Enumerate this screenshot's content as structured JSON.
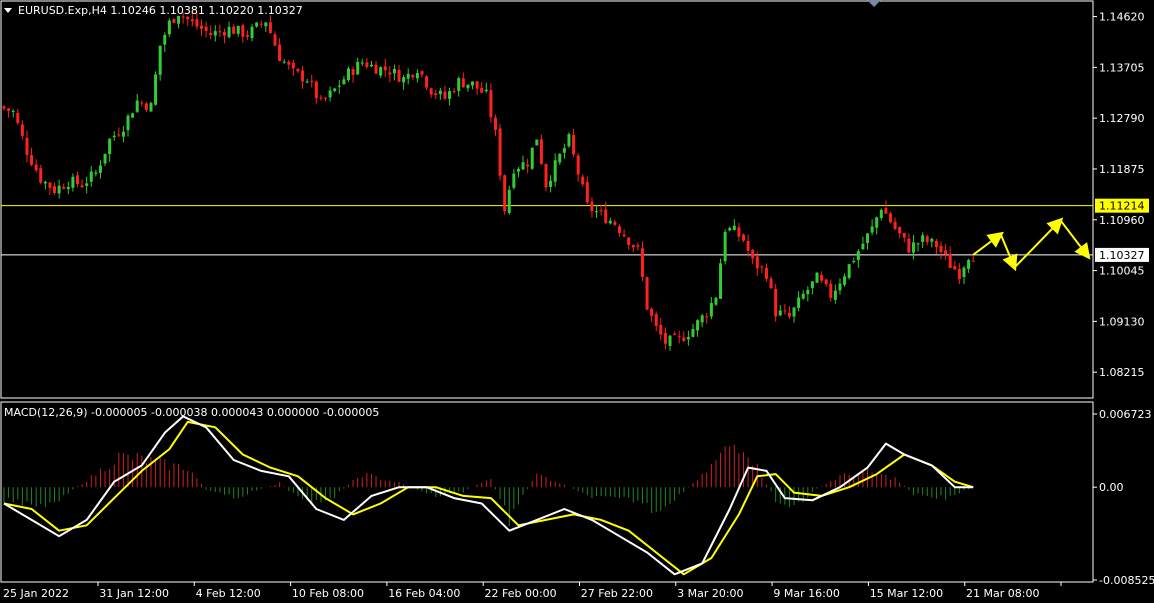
{
  "header": {
    "symbol_line": "EURUSD.Exp,H4  1.10246 1.10381 1.10220 1.10327"
  },
  "indicator": {
    "label": "MACD(12,26,9) -0.000005 -0.000038 0.000043 0.000000 -0.000005"
  },
  "chart_data": {
    "type": "candlestick",
    "symbol": "EURUSD.Exp",
    "timeframe": "H4",
    "ohlc_last": {
      "open": 1.10246,
      "high": 1.10381,
      "low": 1.1022,
      "close": 1.10327
    },
    "price_axis_ticks": [
      "1.14620",
      "1.13705",
      "1.12790",
      "1.11875",
      "1.10960",
      "1.10045",
      "1.09130",
      "1.08215"
    ],
    "price_range": [
      1.0775,
      1.149
    ],
    "horizontal_lines": [
      {
        "price": 1.11214,
        "label": "1.11214",
        "color": "#ffff00"
      },
      {
        "price": 1.10327,
        "label": "1.10327",
        "color": "#ffffff"
      }
    ],
    "time_axis_labels": [
      "25 Jan 2022",
      "31 Jan 12:00",
      "4 Feb 12:00",
      "10 Feb 08:00",
      "16 Feb 04:00",
      "22 Feb 00:00",
      "27 Feb 22:00",
      "3 Mar 20:00",
      "9 Mar 16:00",
      "15 Mar 12:00",
      "21 Mar 08:00"
    ],
    "price_path": [
      {
        "t": 0,
        "p": 1.13
      },
      {
        "t": 3,
        "p": 1.129
      },
      {
        "t": 6,
        "p": 1.122
      },
      {
        "t": 9,
        "p": 1.117
      },
      {
        "t": 12,
        "p": 1.115
      },
      {
        "t": 15,
        "p": 1.1165
      },
      {
        "t": 18,
        "p": 1.116
      },
      {
        "t": 21,
        "p": 1.118
      },
      {
        "t": 24,
        "p": 1.124
      },
      {
        "t": 27,
        "p": 1.1265
      },
      {
        "t": 30,
        "p": 1.131
      },
      {
        "t": 33,
        "p": 1.13
      },
      {
        "t": 35,
        "p": 1.141
      },
      {
        "t": 37,
        "p": 1.145
      },
      {
        "t": 39,
        "p": 1.147
      },
      {
        "t": 42,
        "p": 1.145
      },
      {
        "t": 46,
        "p": 1.143
      },
      {
        "t": 50,
        "p": 1.144
      },
      {
        "t": 54,
        "p": 1.143
      },
      {
        "t": 58,
        "p": 1.1455
      },
      {
        "t": 61,
        "p": 1.139
      },
      {
        "t": 64,
        "p": 1.136
      },
      {
        "t": 67,
        "p": 1.135
      },
      {
        "t": 70,
        "p": 1.1305
      },
      {
        "t": 73,
        "p": 1.133
      },
      {
        "t": 76,
        "p": 1.136
      },
      {
        "t": 79,
        "p": 1.138
      },
      {
        "t": 82,
        "p": 1.137
      },
      {
        "t": 85,
        "p": 1.1365
      },
      {
        "t": 88,
        "p": 1.135
      },
      {
        "t": 91,
        "p": 1.137
      },
      {
        "t": 94,
        "p": 1.133
      },
      {
        "t": 97,
        "p": 1.1315
      },
      {
        "t": 100,
        "p": 1.1345
      },
      {
        "t": 103,
        "p": 1.134
      },
      {
        "t": 106,
        "p": 1.132
      },
      {
        "t": 108,
        "p": 1.125
      },
      {
        "t": 110,
        "p": 1.1115
      },
      {
        "t": 112,
        "p": 1.119
      },
      {
        "t": 115,
        "p": 1.12
      },
      {
        "t": 117,
        "p": 1.1245
      },
      {
        "t": 119,
        "p": 1.116
      },
      {
        "t": 122,
        "p": 1.121
      },
      {
        "t": 124,
        "p": 1.124
      },
      {
        "t": 126,
        "p": 1.118
      },
      {
        "t": 128,
        "p": 1.112
      },
      {
        "t": 131,
        "p": 1.1105
      },
      {
        "t": 134,
        "p": 1.109
      },
      {
        "t": 137,
        "p": 1.106
      },
      {
        "t": 139,
        "p": 1.104
      },
      {
        "t": 141,
        "p": 1.094
      },
      {
        "t": 143,
        "p": 1.09
      },
      {
        "t": 145,
        "p": 1.0875
      },
      {
        "t": 148,
        "p": 1.088
      },
      {
        "t": 151,
        "p": 1.09
      },
      {
        "t": 154,
        "p": 1.093
      },
      {
        "t": 156,
        "p": 1.096
      },
      {
        "t": 158,
        "p": 1.108
      },
      {
        "t": 160,
        "p": 1.1075
      },
      {
        "t": 162,
        "p": 1.106
      },
      {
        "t": 164,
        "p": 1.102
      },
      {
        "t": 167,
        "p": 1.1
      },
      {
        "t": 169,
        "p": 1.093
      },
      {
        "t": 172,
        "p": 1.092
      },
      {
        "t": 175,
        "p": 1.096
      },
      {
        "t": 178,
        "p": 1.099
      },
      {
        "t": 181,
        "p": 1.096
      },
      {
        "t": 184,
        "p": 1.1
      },
      {
        "t": 187,
        "p": 1.104
      },
      {
        "t": 190,
        "p": 1.108
      },
      {
        "t": 192,
        "p": 1.112
      },
      {
        "t": 195,
        "p": 1.108
      },
      {
        "t": 198,
        "p": 1.1045
      },
      {
        "t": 201,
        "p": 1.106
      },
      {
        "t": 204,
        "p": 1.105
      },
      {
        "t": 207,
        "p": 1.1015
      },
      {
        "t": 209,
        "p": 1.1
      },
      {
        "t": 211,
        "p": 1.1033
      }
    ],
    "projection_arrows": [
      {
        "from": {
          "t": 211,
          "p": 1.1033
        },
        "to": {
          "t": 217,
          "p": 1.107
        }
      },
      {
        "from": {
          "t": 217,
          "p": 1.107
        },
        "to": {
          "t": 220,
          "p": 1.101
        }
      },
      {
        "from": {
          "t": 220,
          "p": 1.101
        },
        "to": {
          "t": 230,
          "p": 1.1095
        }
      },
      {
        "from": {
          "t": 230,
          "p": 1.1095
        },
        "to": {
          "t": 236,
          "p": 1.103
        }
      }
    ],
    "macd": {
      "params": "12,26,9",
      "axis_ticks": [
        "0.006723",
        "0.00",
        "-0.008525"
      ],
      "range": [
        -0.008525,
        0.006723
      ],
      "histogram": [
        {
          "t": 0,
          "v": -0.0012
        },
        {
          "t": 10,
          "v": -0.0016
        },
        {
          "t": 20,
          "v": 0.0012
        },
        {
          "t": 25,
          "v": 0.0028
        },
        {
          "t": 30,
          "v": 0.0026
        },
        {
          "t": 36,
          "v": 0.002
        },
        {
          "t": 40,
          "v": 0.0018
        },
        {
          "t": 44,
          "v": -0.0002
        },
        {
          "t": 50,
          "v": -0.001
        },
        {
          "t": 60,
          "v": 0.0004
        },
        {
          "t": 66,
          "v": -0.0016
        },
        {
          "t": 72,
          "v": -0.0008
        },
        {
          "t": 78,
          "v": 0.0012
        },
        {
          "t": 86,
          "v": 0.0004
        },
        {
          "t": 94,
          "v": -0.0008
        },
        {
          "t": 100,
          "v": -0.0004
        },
        {
          "t": 106,
          "v": 0.0008
        },
        {
          "t": 110,
          "v": -0.003
        },
        {
          "t": 116,
          "v": 0.0012
        },
        {
          "t": 120,
          "v": 0.0006
        },
        {
          "t": 126,
          "v": -0.0006
        },
        {
          "t": 130,
          "v": -0.001
        },
        {
          "t": 138,
          "v": -0.0012
        },
        {
          "t": 142,
          "v": -0.0022
        },
        {
          "t": 148,
          "v": -0.0004
        },
        {
          "t": 152,
          "v": 0.001
        },
        {
          "t": 158,
          "v": 0.0038
        },
        {
          "t": 161,
          "v": 0.004
        },
        {
          "t": 164,
          "v": 0.0018
        },
        {
          "t": 168,
          "v": -0.0012
        },
        {
          "t": 172,
          "v": -0.002
        },
        {
          "t": 176,
          "v": -0.0004
        },
        {
          "t": 182,
          "v": 0.001
        },
        {
          "t": 188,
          "v": 0.0014
        },
        {
          "t": 194,
          "v": 0.0008
        },
        {
          "t": 198,
          "v": -0.0006
        },
        {
          "t": 205,
          "v": -0.001
        },
        {
          "t": 211,
          "v": 0.0
        }
      ],
      "macd_line": [
        {
          "t": 0,
          "v": -0.0015
        },
        {
          "t": 6,
          "v": -0.003
        },
        {
          "t": 12,
          "v": -0.0045
        },
        {
          "t": 18,
          "v": -0.003
        },
        {
          "t": 24,
          "v": 0.0005
        },
        {
          "t": 30,
          "v": 0.002
        },
        {
          "t": 35,
          "v": 0.005
        },
        {
          "t": 39,
          "v": 0.0065
        },
        {
          "t": 44,
          "v": 0.0055
        },
        {
          "t": 50,
          "v": 0.0025
        },
        {
          "t": 56,
          "v": 0.0015
        },
        {
          "t": 62,
          "v": 0.001
        },
        {
          "t": 68,
          "v": -0.002
        },
        {
          "t": 74,
          "v": -0.003
        },
        {
          "t": 80,
          "v": -0.0008
        },
        {
          "t": 86,
          "v": 0.0
        },
        {
          "t": 92,
          "v": 0.0
        },
        {
          "t": 98,
          "v": -0.001
        },
        {
          "t": 104,
          "v": -0.0015
        },
        {
          "t": 110,
          "v": -0.004
        },
        {
          "t": 116,
          "v": -0.003
        },
        {
          "t": 122,
          "v": -0.002
        },
        {
          "t": 128,
          "v": -0.003
        },
        {
          "t": 134,
          "v": -0.0045
        },
        {
          "t": 140,
          "v": -0.006
        },
        {
          "t": 146,
          "v": -0.008
        },
        {
          "t": 152,
          "v": -0.007
        },
        {
          "t": 158,
          "v": -0.002
        },
        {
          "t": 162,
          "v": 0.0018
        },
        {
          "t": 166,
          "v": 0.0015
        },
        {
          "t": 170,
          "v": -0.001
        },
        {
          "t": 176,
          "v": -0.0012
        },
        {
          "t": 182,
          "v": 0.0
        },
        {
          "t": 188,
          "v": 0.0018
        },
        {
          "t": 192,
          "v": 0.004
        },
        {
          "t": 196,
          "v": 0.003
        },
        {
          "t": 202,
          "v": 0.002
        },
        {
          "t": 207,
          "v": 0.0
        },
        {
          "t": 211,
          "v": 0.0
        }
      ],
      "signal_line": [
        {
          "t": 0,
          "v": -0.0015
        },
        {
          "t": 6,
          "v": -0.002
        },
        {
          "t": 12,
          "v": -0.004
        },
        {
          "t": 18,
          "v": -0.0035
        },
        {
          "t": 24,
          "v": -0.001
        },
        {
          "t": 30,
          "v": 0.0015
        },
        {
          "t": 36,
          "v": 0.0035
        },
        {
          "t": 40,
          "v": 0.006
        },
        {
          "t": 46,
          "v": 0.0055
        },
        {
          "t": 52,
          "v": 0.003
        },
        {
          "t": 58,
          "v": 0.0018
        },
        {
          "t": 64,
          "v": 0.001
        },
        {
          "t": 70,
          "v": -0.001
        },
        {
          "t": 76,
          "v": -0.0025
        },
        {
          "t": 82,
          "v": -0.0015
        },
        {
          "t": 88,
          "v": 0.0
        },
        {
          "t": 94,
          "v": 0.0
        },
        {
          "t": 100,
          "v": -0.0008
        },
        {
          "t": 106,
          "v": -0.001
        },
        {
          "t": 112,
          "v": -0.0035
        },
        {
          "t": 118,
          "v": -0.003
        },
        {
          "t": 124,
          "v": -0.0025
        },
        {
          "t": 130,
          "v": -0.003
        },
        {
          "t": 136,
          "v": -0.004
        },
        {
          "t": 142,
          "v": -0.006
        },
        {
          "t": 148,
          "v": -0.008
        },
        {
          "t": 154,
          "v": -0.0065
        },
        {
          "t": 160,
          "v": -0.0025
        },
        {
          "t": 164,
          "v": 0.001
        },
        {
          "t": 168,
          "v": 0.0012
        },
        {
          "t": 172,
          "v": -0.0005
        },
        {
          "t": 178,
          "v": -0.0008
        },
        {
          "t": 184,
          "v": 0.0
        },
        {
          "t": 190,
          "v": 0.0012
        },
        {
          "t": 196,
          "v": 0.003
        },
        {
          "t": 202,
          "v": 0.002
        },
        {
          "t": 207,
          "v": 0.0005
        },
        {
          "t": 211,
          "v": 0.0
        }
      ]
    },
    "colors": {
      "background": "#000000",
      "bull": "#32cd32",
      "bear": "#ff2020",
      "hist_pos": "#cc2222",
      "hist_neg": "#228822",
      "macd_line": "#ffffff",
      "signal_line": "#ffff00",
      "hline_yellow": "#ffff00",
      "hline_white": "#ffffff",
      "projection": "#ffff00",
      "grid_frame": "#ffffff"
    }
  }
}
